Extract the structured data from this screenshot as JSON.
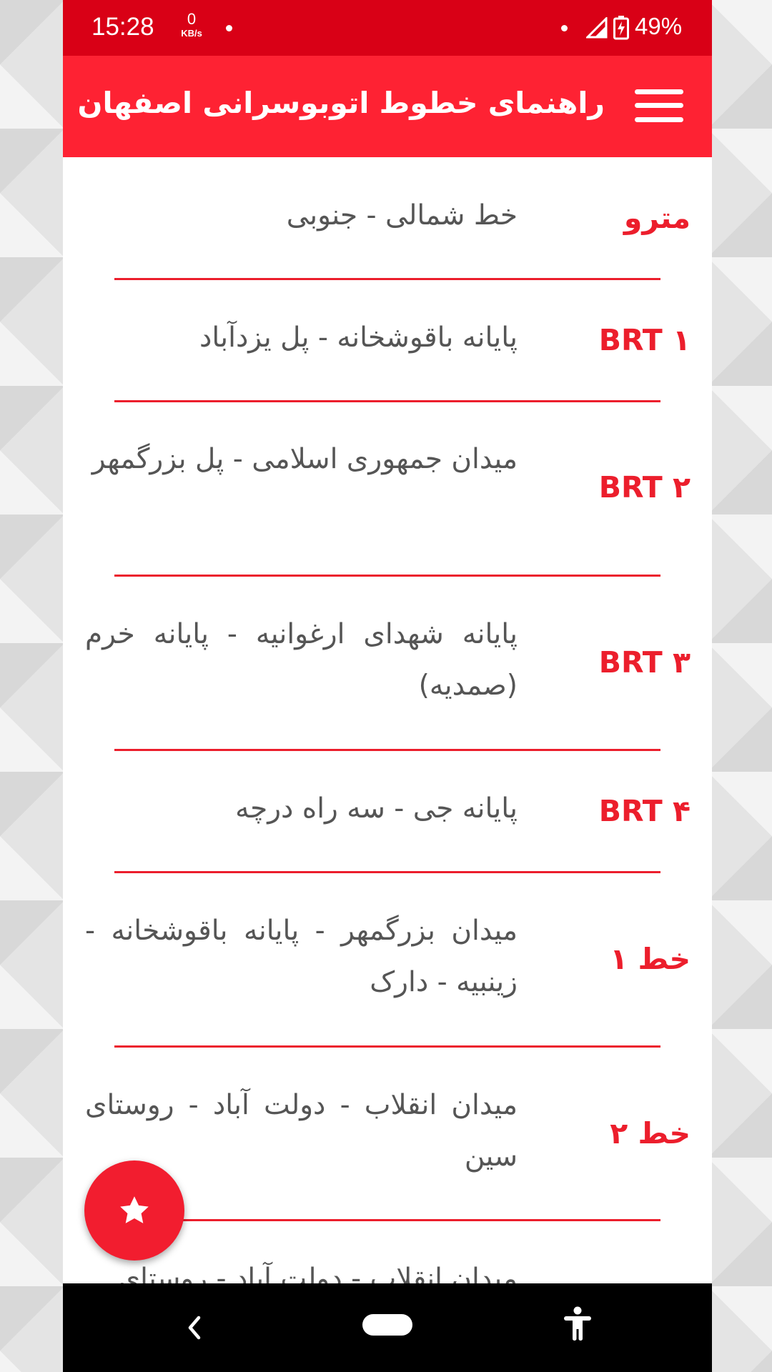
{
  "status_bar": {
    "time": "15:28",
    "net_speed_value": "0",
    "net_speed_unit": "KB/s",
    "battery": "49%"
  },
  "app_bar": {
    "title": "راهنمای خطوط اتوبوسرانی اصفهان",
    "menu_icon": "hamburger-menu-icon"
  },
  "lines": [
    {
      "name": "مترو",
      "route": "خط شمالی - جنوبی"
    },
    {
      "name": "BRT ۱",
      "route": "پایانه باقوشخانه - پل یزدآباد"
    },
    {
      "name": "BRT ۲",
      "route": "میدان جمهوری اسلامی - پل بزرگمهر"
    },
    {
      "name": "BRT ۳",
      "route": "پایانه شهدای ارغوانیه - پایانه خرم (صمدیه)"
    },
    {
      "name": "BRT ۴",
      "route": "پایانه جی - سه راه درچه"
    },
    {
      "name": "خط ۱",
      "route": "میدان بزرگمهر - پایانه باقوشخانه - زینبیه - دارک"
    },
    {
      "name": "خط ۲",
      "route": "میدان انقلاب - دولت آباد - روستای سین"
    },
    {
      "name": "",
      "route": "میدان انقلاب - دولت آباد - روستای"
    }
  ],
  "fab": {
    "icon": "star-icon"
  },
  "nav_bar": {
    "back_icon": "back-icon",
    "home_icon": "home-pill-icon",
    "accessibility_icon": "accessibility-icon"
  },
  "colors": {
    "status_bar": "#d90016",
    "app_bar": "#fe2233",
    "accent": "#ec1e2c",
    "route_text": "#555555"
  }
}
